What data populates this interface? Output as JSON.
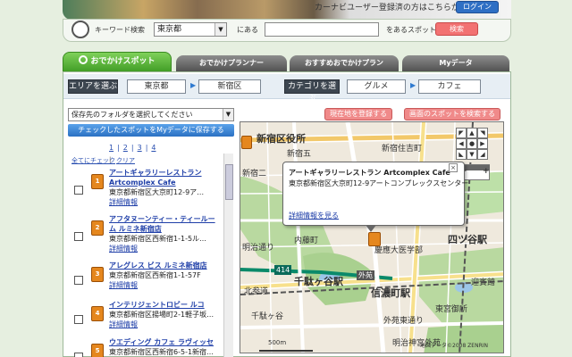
{
  "header": {
    "banner_note": "カーナビユーザー登録済の方はこちらから",
    "login_label": "ログイン",
    "keyword_label": "キーワード検索",
    "area_value": "東京都",
    "aru_label": "にある",
    "wo_aru_label": "をあるスポットを",
    "search_label": "検索"
  },
  "tabs": [
    {
      "label": "おでかけスポット",
      "active": true
    },
    {
      "label": "おでかけプランナー",
      "active": false
    },
    {
      "label": "おすすめおでかけプラン",
      "active": false
    },
    {
      "label": "Myデータ",
      "active": false
    }
  ],
  "crumbs": {
    "area_head": "エリアを選ぶ",
    "area1": "東京都",
    "area2": "新宿区",
    "cat_head": "カテゴリを選ぶ",
    "cat1": "グルメ",
    "cat2": "カフェ"
  },
  "left": {
    "folder_select": "保存先のフォルダを選択してください",
    "save_button": "チェックしたスポットをMyデータに保存する",
    "pages": [
      "1",
      "2",
      "3",
      "4"
    ],
    "check_all": "全てにチェック",
    "clear": "クリア",
    "items": [
      {
        "marker": "1",
        "name": "アートギャラリーレストラン",
        "name2": "Artcomplex Cafe",
        "addr": "東京都新宿区大京町12-9ア…",
        "detail": "詳細情報"
      },
      {
        "marker": "2",
        "name": "アフタヌーンティー・ティールー",
        "name2": "ム ルミネ新宿店",
        "addr": "東京都新宿区西新宿1-1-5ル…",
        "detail": "詳細情報"
      },
      {
        "marker": "3",
        "name": "アレグレス ビス ルミネ新宿店",
        "name2": "",
        "addr": "東京都新宿区西新宿1-1-57F",
        "detail": "詳細情報"
      },
      {
        "marker": "4",
        "name": "インテリジェントロビー ルコ",
        "name2": "",
        "addr": "東京都新宿区揚場町2-1軽子坂…",
        "detail": "詳細情報"
      },
      {
        "marker": "5",
        "name": "ウエディング カフェ ラヴィッセ",
        "name2": "",
        "addr": "東京都新宿区西新宿6-5-1新宿…",
        "detail": ""
      }
    ]
  },
  "map": {
    "locate_button": "現在地を登録する",
    "show_button": "画面のスポットを検索する",
    "popup": {
      "title": "アートギャラリーレストラン Artcomplex Cafe",
      "addr": "東京都新宿区大京町12-9アートコンプレックスセンター",
      "link": "詳細情報を見る",
      "close": "×"
    },
    "labels": {
      "ward_office": "新宿区役所",
      "shinjuku5": "新宿五",
      "shinjuku_sumiyoshi": "新宿住吉町",
      "shinjuku2": "新宿二",
      "naito": "内藤町",
      "yotsuya_st": "四ツ谷駅",
      "sendagaya": "千駄ヶ谷駅",
      "shinanomachi": "信濃町駅",
      "gaien": "外苑",
      "hospital": "慶應大医学部",
      "gaien_dori": "外苑東通り",
      "meiji": "明治神宮外苑",
      "geihinkan": "迎賓館",
      "togu": "東宮御所",
      "higashimiyamachi": "東宮御所",
      "road414": "414",
      "kitaando": "北参道",
      "meiji_dori": "明治通り",
      "sendagaya_label": "千駄ヶ谷",
      "scale": "500m",
      "copyright": "地図データ©2008 ZENRIN"
    }
  }
}
